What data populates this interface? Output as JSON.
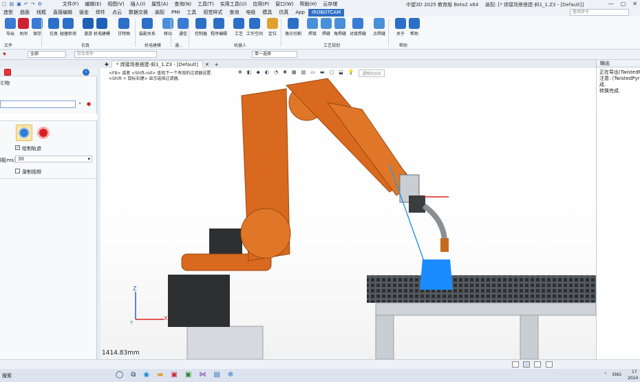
{
  "titlebar": {
    "menus": [
      "文件(F)",
      "编辑(E)",
      "视图(V)",
      "插入(I)",
      "属性(A)",
      "查询(N)",
      "工具(T)",
      "实用工具(U)",
      "应用(P)",
      "窗口(W)",
      "帮助(H)",
      "云存储"
    ],
    "app_title": "中望3D  2025 教育版 Beta2 x64",
    "doc_title": "装配: [* 焊接场景搭建-斜1_1.Z3 - [Default]]"
  },
  "tabs": [
    "造型",
    "曲面",
    "线框",
    "直接编辑",
    "钣金",
    "焊件",
    "点云",
    "数据交换",
    "装配",
    "PMI",
    "工具",
    "视觉样式",
    "查询",
    "电极",
    "模具",
    "仿真",
    "App",
    "IROBOTCAM"
  ],
  "search_placeholder": "查找命令",
  "ribbon": {
    "buttons": [
      {
        "label": "导出",
        "icon": "export-icon"
      },
      {
        "label": "关闭",
        "icon": "close-doc-icon"
      },
      {
        "label": "保存",
        "icon": "save-icon"
      },
      {
        "label": "仿真",
        "icon": "simulate-icon"
      },
      {
        "label": "碰撞检测",
        "icon": "collision-icon"
      },
      {
        "label": "漫游",
        "icon": "walk-icon"
      },
      {
        "label": "机电建模",
        "icon": "mechatronic-icon"
      },
      {
        "label": "甘特图",
        "icon": "gantt-icon"
      },
      {
        "label": "装配关系",
        "icon": "assembly-relation-icon"
      },
      {
        "label": "移动",
        "icon": "move-icon"
      },
      {
        "label": "通信",
        "icon": "communication-icon"
      },
      {
        "label": "控制器",
        "icon": "controller-icon"
      },
      {
        "label": "程序编辑",
        "icon": "program-edit-icon"
      },
      {
        "label": "工艺",
        "icon": "process-icon"
      },
      {
        "label": "工作空间",
        "icon": "workspace-icon"
      },
      {
        "label": "定位",
        "icon": "locate-icon"
      },
      {
        "label": "激光切割",
        "icon": "laser-cut-icon"
      },
      {
        "label": "焊接",
        "icon": "weld-icon"
      },
      {
        "label": "焊缝",
        "icon": "weld-seam-icon"
      },
      {
        "label": "角焊缝",
        "icon": "fillet-weld-icon"
      },
      {
        "label": "对接焊缝",
        "icon": "butt-weld-icon"
      },
      {
        "label": "点焊缝",
        "icon": "spot-weld-icon"
      },
      {
        "label": "关于",
        "icon": "about-icon"
      },
      {
        "label": "帮助",
        "icon": "help-icon"
      }
    ],
    "groups": [
      "文件",
      "仿真",
      "机电建模",
      "通...",
      "机器人",
      "工艺规划",
      "帮助"
    ]
  },
  "toolbar": {
    "filter_value": "全部",
    "part_placeholder": "仅合零件",
    "select_mode": "单一选择"
  },
  "left_panel": {
    "section": "Ⓔ物",
    "checkbox_draw_label": "绘制轨迹",
    "checkbox_draw": true,
    "interval_label": "隔[ms]",
    "interval_value": "30",
    "checkbox_record_label": "录制视频",
    "checkbox_record": false
  },
  "document_tab": "* 焊接场景搭建-斜1_1.Z3 - [Default]",
  "viewport": {
    "hint_line1": "<F8> 或者 <Shift-roll> 查找下一个有效的过滤器设置.",
    "hint_line2": "<Shift + 鼠标右键> 显示选择过滤器.",
    "measure": "1414.83mm",
    "axis_x": "X",
    "axis_y": "Y",
    "axis_z": "Z",
    "transparency": "透明0000"
  },
  "output_panel": {
    "title": "输出",
    "lines": [
      "正在导出(TwistedPyr",
      "注意: (TwistedPyram",
      "成.",
      "转换完成."
    ]
  },
  "taskbar": {
    "search_text": "搜索",
    "ime": "ENG",
    "time": "17",
    "date": "2024"
  },
  "colors": {
    "robot": "#d9691e",
    "accent": "#2e6fc7",
    "workpiece": "#1a8cff",
    "laser": "#2e9ae8"
  }
}
